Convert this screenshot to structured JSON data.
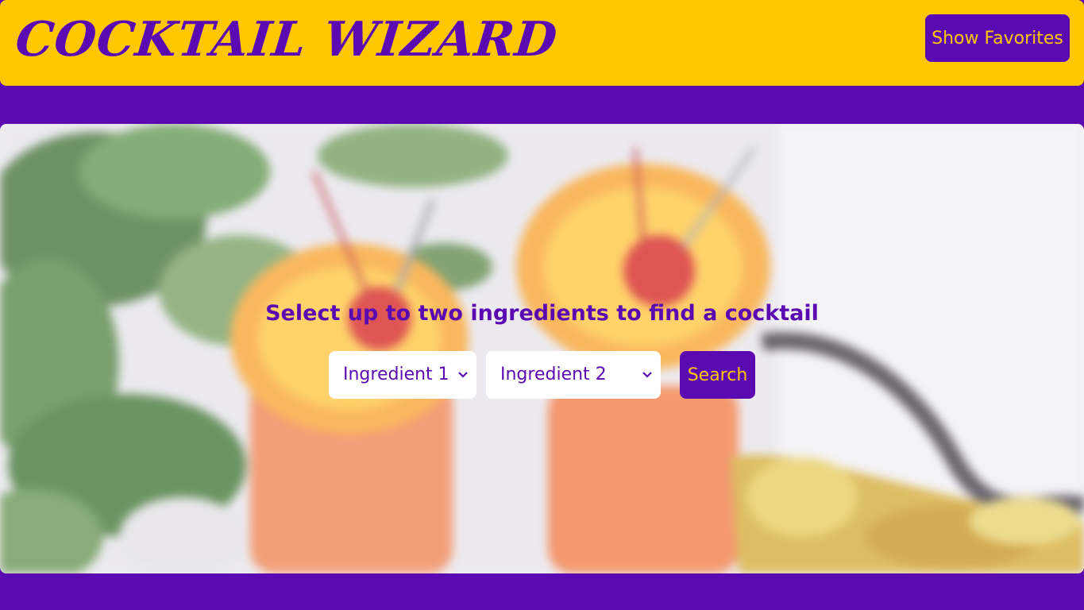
{
  "header": {
    "logo_text": "COCKTAIL WIZARD",
    "favorites_label": "Show Favorites"
  },
  "hero": {
    "background_image": "blurred-cocktails-photo",
    "prompt": "Select up to two ingredients to find a cocktail",
    "ingredient1_selected": "Ingredient 1",
    "ingredient2_selected": "Ingredient 2",
    "search_label": "Search"
  },
  "colors": {
    "primary": "#5a0ab0",
    "accent": "#ffc700",
    "white": "#ffffff"
  },
  "icons": {
    "dropdown": "chevron-down-icon"
  }
}
